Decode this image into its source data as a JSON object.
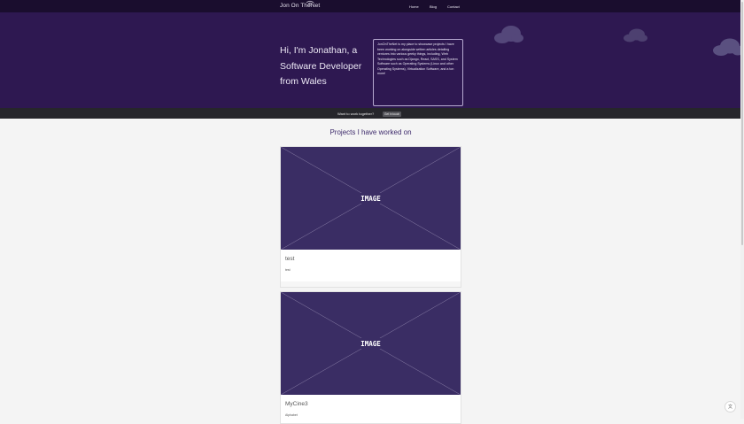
{
  "navbar": {
    "brand": "Jon On TheNet",
    "links": [
      {
        "label": "Home"
      },
      {
        "label": "Blog"
      },
      {
        "label": "Contact"
      }
    ]
  },
  "hero": {
    "title": "Hi, I'm Jonathan, a Software Developer from Wales",
    "about": "JonOnTheNet is my place to showcase projects I have been working on alongside written articles detailing ventures into various geeky things, including, Web Technologies such as Django, React, SASS, and System Software such as Operating Systems (Linux and other Operating Systems), Virtualization Software, and a ton more!"
  },
  "cta": {
    "text": "Want to work together?",
    "button": "Get in touch"
  },
  "projects": {
    "heading": "Projects I have worked on",
    "image_placeholder": "IMAGE",
    "items": [
      {
        "title": "test",
        "description": "test"
      },
      {
        "title": "MyCine3",
        "description": "Alphabet"
      }
    ]
  },
  "fab": {
    "icon": "translate-icon",
    "label": "文"
  },
  "colors": {
    "navbar": "#1a0d2e",
    "hero": "#2e1851",
    "cta_bar": "#26262b",
    "placeholder": "#3a2d64",
    "accent": "#3d2a6b"
  }
}
